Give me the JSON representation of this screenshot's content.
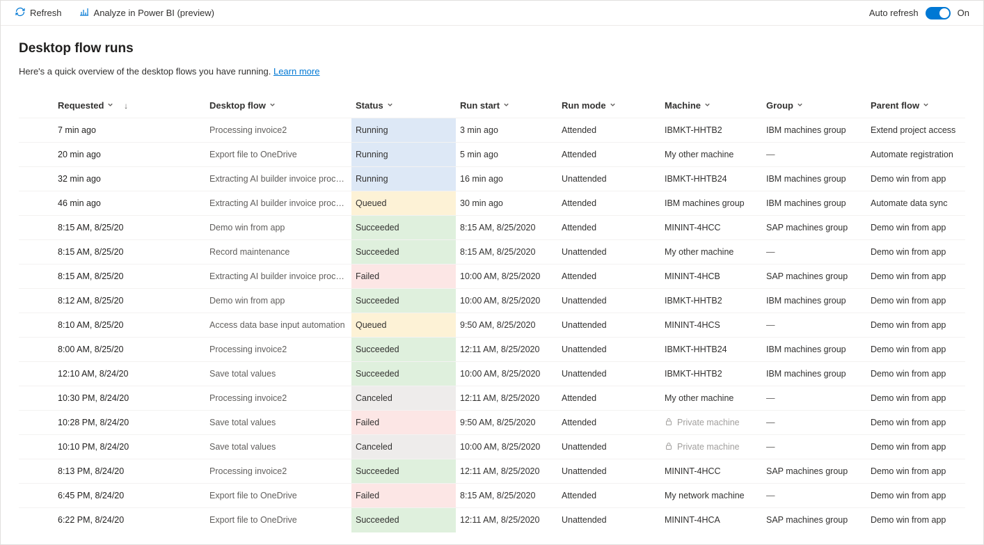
{
  "toolbar": {
    "refresh": "Refresh",
    "analyze": "Analyze in Power BI (preview)",
    "auto_refresh_label": "Auto refresh",
    "auto_refresh_state": "On"
  },
  "header": {
    "title": "Desktop flow runs",
    "subtitle_prefix": "Here's a quick overview of the desktop flows you have running. ",
    "learn_more": "Learn more"
  },
  "columns": {
    "requested": "Requested",
    "desktop_flow": "Desktop flow",
    "status": "Status",
    "run_start": "Run start",
    "run_mode": "Run mode",
    "machine": "Machine",
    "group": "Group",
    "parent_flow": "Parent flow"
  },
  "status_labels": {
    "running": "Running",
    "queued": "Queued",
    "succeeded": "Succeeded",
    "failed": "Failed",
    "canceled": "Canceled"
  },
  "private_machine_label": "Private machine",
  "dash": "—",
  "rows": [
    {
      "requested": "7 min ago",
      "flow": "Processing invoice2",
      "status": "running",
      "run_start": "3 min ago",
      "mode": "Attended",
      "machine": "IBMKT-HHTB2",
      "group": "IBM machines group",
      "parent": "Extend project access"
    },
    {
      "requested": "20 min ago",
      "flow": "Export file to OneDrive",
      "status": "running",
      "run_start": "5 min ago",
      "mode": "Attended",
      "machine": "My other machine",
      "group": "",
      "parent": "Automate registration"
    },
    {
      "requested": "32 min ago",
      "flow": "Extracting AI builder invoice proce...",
      "status": "running",
      "run_start": "16 min ago",
      "mode": "Unattended",
      "machine": "IBMKT-HHTB24",
      "group": "IBM machines group",
      "parent": "Demo win from app"
    },
    {
      "requested": "46 min ago",
      "flow": "Extracting AI builder invoice proce...",
      "status": "queued",
      "run_start": "30 min ago",
      "mode": "Attended",
      "machine": "IBM machines group",
      "group": "IBM machines group",
      "parent": "Automate data sync"
    },
    {
      "requested": "8:15 AM, 8/25/20",
      "flow": "Demo win from app",
      "status": "succeeded",
      "run_start": "8:15 AM, 8/25/2020",
      "mode": "Attended",
      "machine": "MININT-4HCC",
      "group": "SAP machines group",
      "parent": "Demo win from app"
    },
    {
      "requested": "8:15 AM, 8/25/20",
      "flow": "Record maintenance",
      "status": "succeeded",
      "run_start": "8:15 AM, 8/25/2020",
      "mode": "Unattended",
      "machine": "My other machine",
      "group": "",
      "parent": "Demo win from app"
    },
    {
      "requested": "8:15 AM, 8/25/20",
      "flow": "Extracting AI builder invoice proce...",
      "status": "failed",
      "run_start": "10:00 AM, 8/25/2020",
      "mode": "Attended",
      "machine": "MININT-4HCB",
      "group": "SAP machines group",
      "parent": "Demo win from app"
    },
    {
      "requested": "8:12 AM, 8/25/20",
      "flow": "Demo win from app",
      "status": "succeeded",
      "run_start": "10:00 AM, 8/25/2020",
      "mode": "Unattended",
      "machine": "IBMKT-HHTB2",
      "group": "IBM machines group",
      "parent": "Demo win from app"
    },
    {
      "requested": "8:10 AM, 8/25/20",
      "flow": "Access data base input automation",
      "status": "queued",
      "run_start": "9:50 AM, 8/25/2020",
      "mode": "Unattended",
      "machine": "MININT-4HCS",
      "group": "",
      "parent": "Demo win from app"
    },
    {
      "requested": "8:00 AM, 8/25/20",
      "flow": "Processing invoice2",
      "status": "succeeded",
      "run_start": "12:11 AM, 8/25/2020",
      "mode": "Unattended",
      "machine": "IBMKT-HHTB24",
      "group": "IBM machines group",
      "parent": "Demo win from app"
    },
    {
      "requested": "12:10 AM, 8/24/20",
      "flow": "Save total values",
      "status": "succeeded",
      "run_start": "10:00 AM, 8/25/2020",
      "mode": "Unattended",
      "machine": "IBMKT-HHTB2",
      "group": "IBM machines group",
      "parent": "Demo win from app"
    },
    {
      "requested": "10:30 PM, 8/24/20",
      "flow": "Processing invoice2",
      "status": "canceled",
      "run_start": "12:11 AM, 8/25/2020",
      "mode": "Attended",
      "machine": "My other machine",
      "group": "",
      "parent": "Demo win from app"
    },
    {
      "requested": "10:28 PM, 8/24/20",
      "flow": "Save total values",
      "status": "failed",
      "run_start": "9:50 AM, 8/25/2020",
      "mode": "Attended",
      "machine": "__private__",
      "group": "",
      "parent": "Demo win from app"
    },
    {
      "requested": "10:10 PM, 8/24/20",
      "flow": "Save total values",
      "status": "canceled",
      "run_start": "10:00 AM, 8/25/2020",
      "mode": "Unattended",
      "machine": "__private__",
      "group": "",
      "parent": "Demo win from app"
    },
    {
      "requested": "8:13 PM, 8/24/20",
      "flow": "Processing invoice2",
      "status": "succeeded",
      "run_start": "12:11 AM, 8/25/2020",
      "mode": "Unattended",
      "machine": "MININT-4HCC",
      "group": "SAP machines group",
      "parent": "Demo win from app"
    },
    {
      "requested": "6:45 PM, 8/24/20",
      "flow": "Export file to OneDrive",
      "status": "failed",
      "run_start": "8:15 AM, 8/25/2020",
      "mode": "Attended",
      "machine": "My network machine",
      "group": "",
      "parent": "Demo win from app"
    },
    {
      "requested": "6:22 PM, 8/24/20",
      "flow": "Export file to OneDrive",
      "status": "succeeded",
      "run_start": "12:11 AM, 8/25/2020",
      "mode": "Unattended",
      "machine": "MININT-4HCA",
      "group": "SAP machines group",
      "parent": "Demo win from app"
    }
  ]
}
